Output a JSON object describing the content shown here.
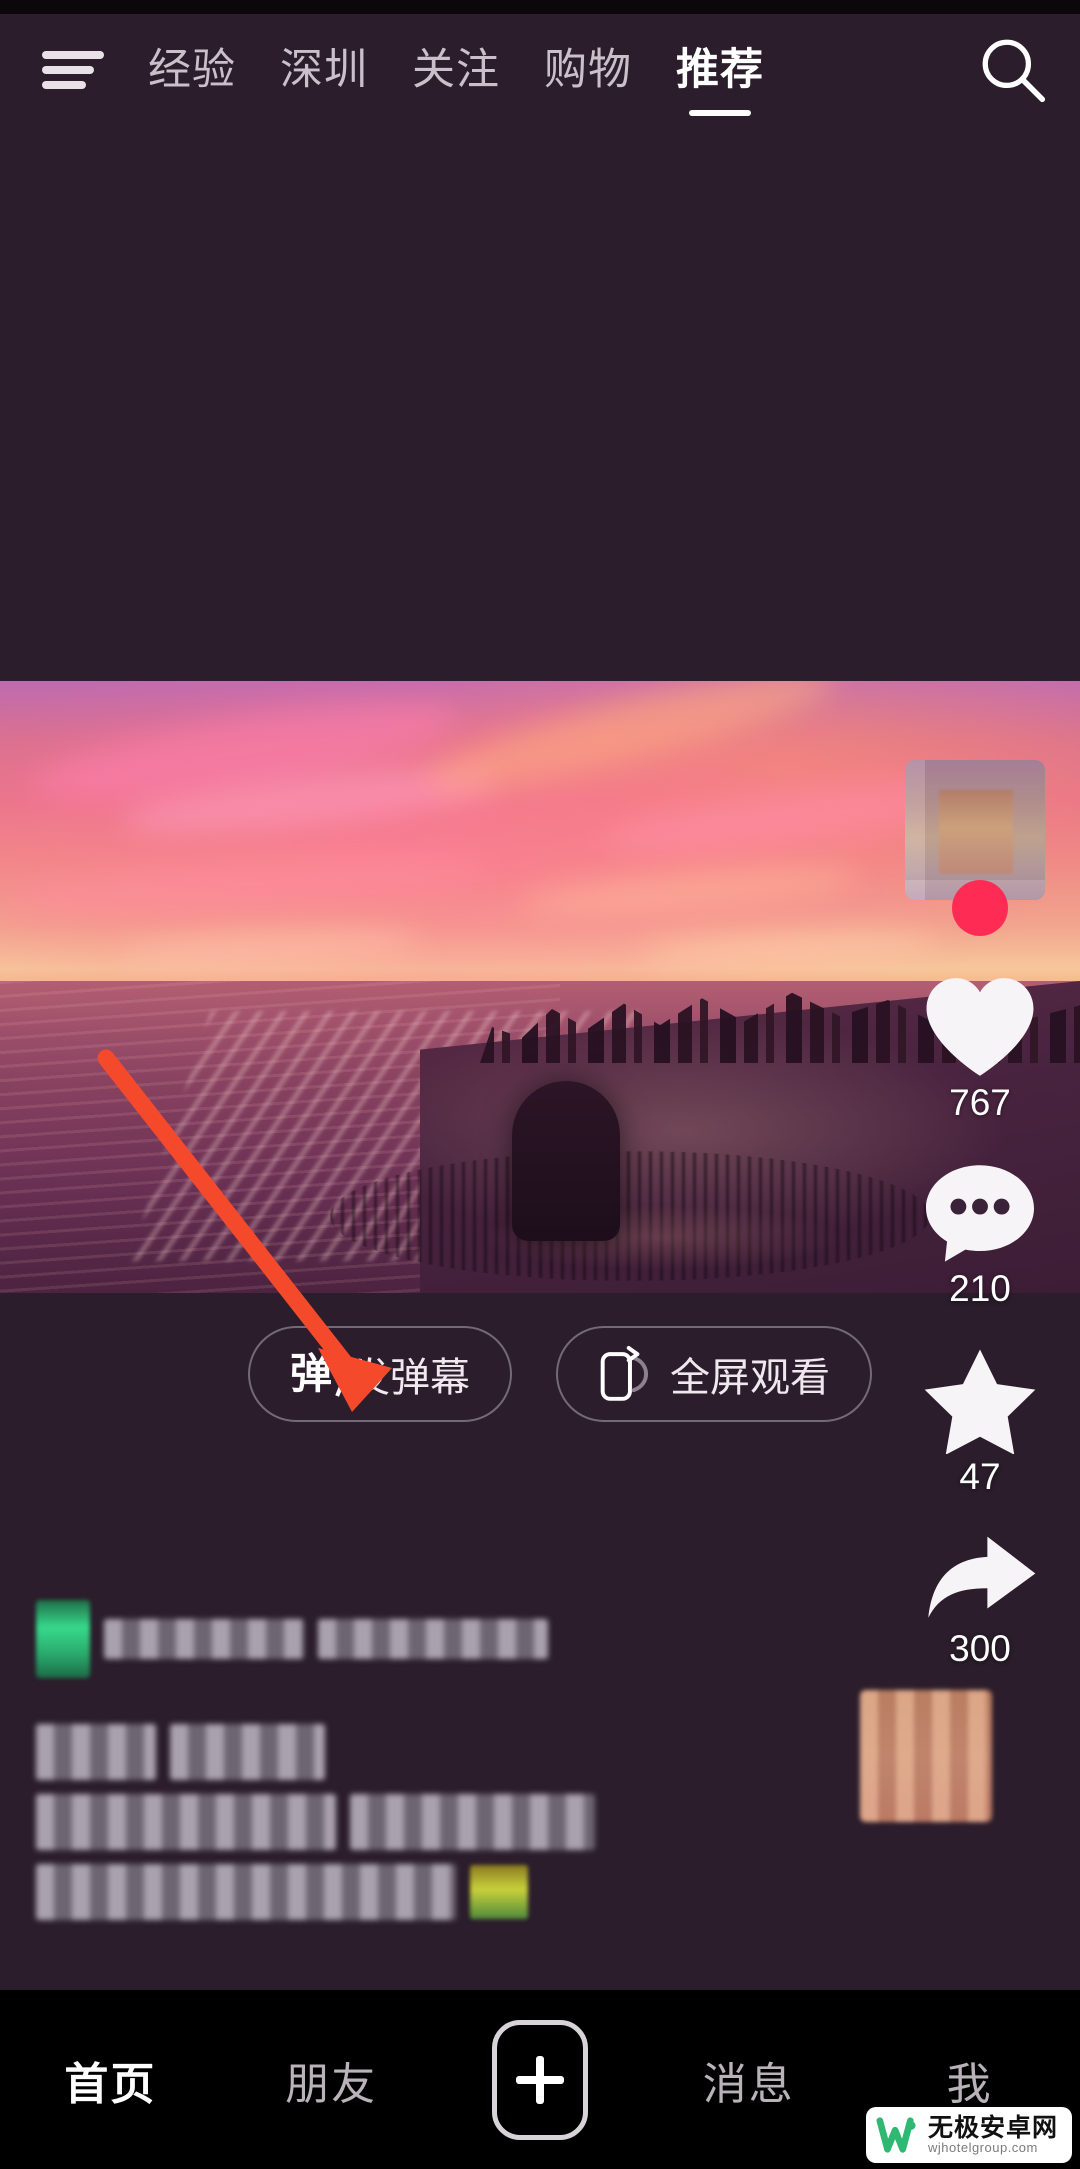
{
  "app": {
    "theme_bg": "#2b1d2b",
    "accent": "#fe2c55",
    "annotation_color": "#f5492c"
  },
  "topnav": {
    "menu_icon": "hamburger-menu-icon",
    "search_icon": "search-icon",
    "tabs": [
      {
        "label": "经验",
        "active": false
      },
      {
        "label": "深圳",
        "active": false
      },
      {
        "label": "关注",
        "active": false
      },
      {
        "label": "购物",
        "active": false
      },
      {
        "label": "推荐",
        "active": true
      }
    ]
  },
  "video": {
    "scene_description": "sunset-beach-aerial",
    "author_avatar": "blurred-avatar",
    "follow_badge": "plus-follow-badge"
  },
  "rail": {
    "items": [
      {
        "icon": "heart-icon",
        "count": "767"
      },
      {
        "icon": "comment-icon",
        "count": "210"
      },
      {
        "icon": "star-icon",
        "count": "47"
      },
      {
        "icon": "share-icon",
        "count": "300"
      }
    ]
  },
  "pills": [
    {
      "icon": "danmaku-icon",
      "icon_glyph": "弹",
      "label": "发弹幕"
    },
    {
      "icon": "fullscreen-rotate-icon",
      "label": "全屏观看"
    }
  ],
  "description": {
    "blurred": true,
    "note": "content redacted by pixelation"
  },
  "bottomnav": {
    "items": [
      {
        "label": "首页",
        "active": true
      },
      {
        "label": "朋友",
        "active": false
      },
      {
        "label": "",
        "active": false,
        "icon": "plus-button"
      },
      {
        "label": "消息",
        "active": false
      },
      {
        "label": "我",
        "active": false
      }
    ]
  },
  "watermark": {
    "name": "无极安卓网",
    "url": "wjhotelgroup.com",
    "logo": "w-logo",
    "logo_color": "#2eb872"
  }
}
